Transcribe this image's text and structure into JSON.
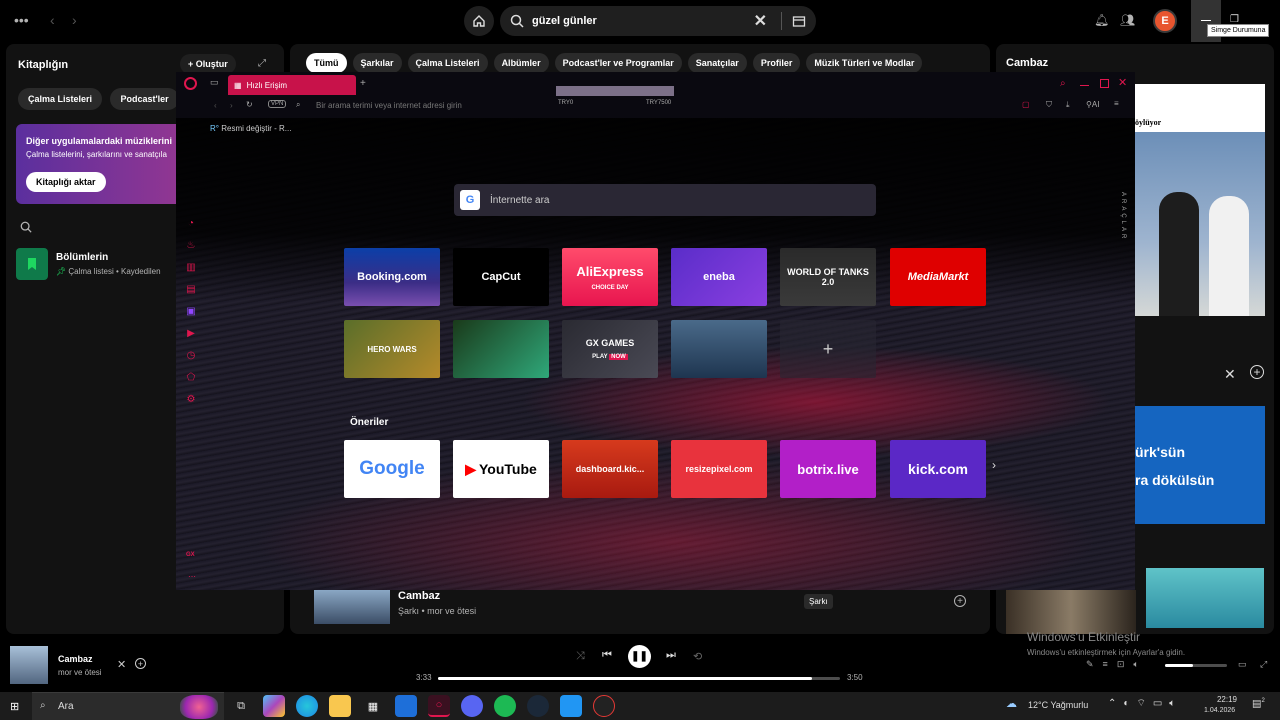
{
  "spotify": {
    "search_value": "güzel günler",
    "avatar_letter": "E",
    "tooltip": "Simge Durumuna",
    "library": {
      "title": "Kitaplığın",
      "create": "Oluştur",
      "chips": [
        "Çalma Listeleri",
        "Podcast'ler"
      ],
      "promo_title": "Diğer uygulamalardaki müziklerini",
      "promo_sub": "Çalma listelerini, şarkılarını ve sanatçıla",
      "promo_button": "Kitaplığı aktar",
      "item_title": "Bölümlerin",
      "item_sub": "Çalma listesi • Kaydedilen"
    },
    "filters": [
      "Tümü",
      "Şarkılar",
      "Çalma Listeleri",
      "Albümler",
      "Podcast'ler ve Programlar",
      "Sanatçılar",
      "Profiler",
      "Müzik Türleri ve Modlar"
    ],
    "right_title": "Cambaz",
    "right_text_1": "öylüyor",
    "right_text_2": "ürk'sün",
    "right_text_3": "ra dökülsün",
    "result_title": "Cambaz",
    "result_sub": "Şarkı • mor ve ötesi",
    "result_badge": "Şarkı",
    "player": {
      "title": "Cambaz",
      "artist": "mor ve ötesi",
      "elapsed": "3:33",
      "total": "3:50",
      "progress": 0.93
    }
  },
  "opera": {
    "tab_label": "Hızlı Erişim",
    "address_placeholder": "Bir arama terimi veya internet adresi girin",
    "vpn": "VPN",
    "ai_label": "AI",
    "price_left": "TRY0",
    "price_right": "TRY7500",
    "bookmark": "Resmi değiştir - R...",
    "search_placeholder": "İnternette ara",
    "side_text": "ARAÇLAR",
    "tiles_row1": [
      "Booking.com",
      "CapCut",
      "AliExpress",
      "eneba",
      "WORLD OF TANKS 2.0",
      "MediaMarkt"
    ],
    "aliexpress_badge": "CHOICE DAY",
    "tiles_row2": [
      "HERO WARS",
      "",
      "GX GAMES",
      "",
      "+"
    ],
    "gx_games_play": "PLAY",
    "gx_games_now": "NOW",
    "suggestions_title": "Öneriler",
    "suggestions": [
      "Google",
      "YouTube",
      "dashboard.kic...",
      "resizepixel.com",
      "botrix.live",
      "kick.com"
    ],
    "gx_label": "GX"
  },
  "windows": {
    "activate_title": "Windows'u Etkinleştir",
    "activate_sub": "Windows'u etkinleştirmek için Ayarlar'a gidin.",
    "search": "Ara",
    "weather": "12°C Yağmurlu",
    "time": "22:19",
    "date": "1.04.2026",
    "notif_count": "2"
  },
  "colors": {
    "accent": "#c8124a",
    "spotify_green": "#1db954"
  }
}
